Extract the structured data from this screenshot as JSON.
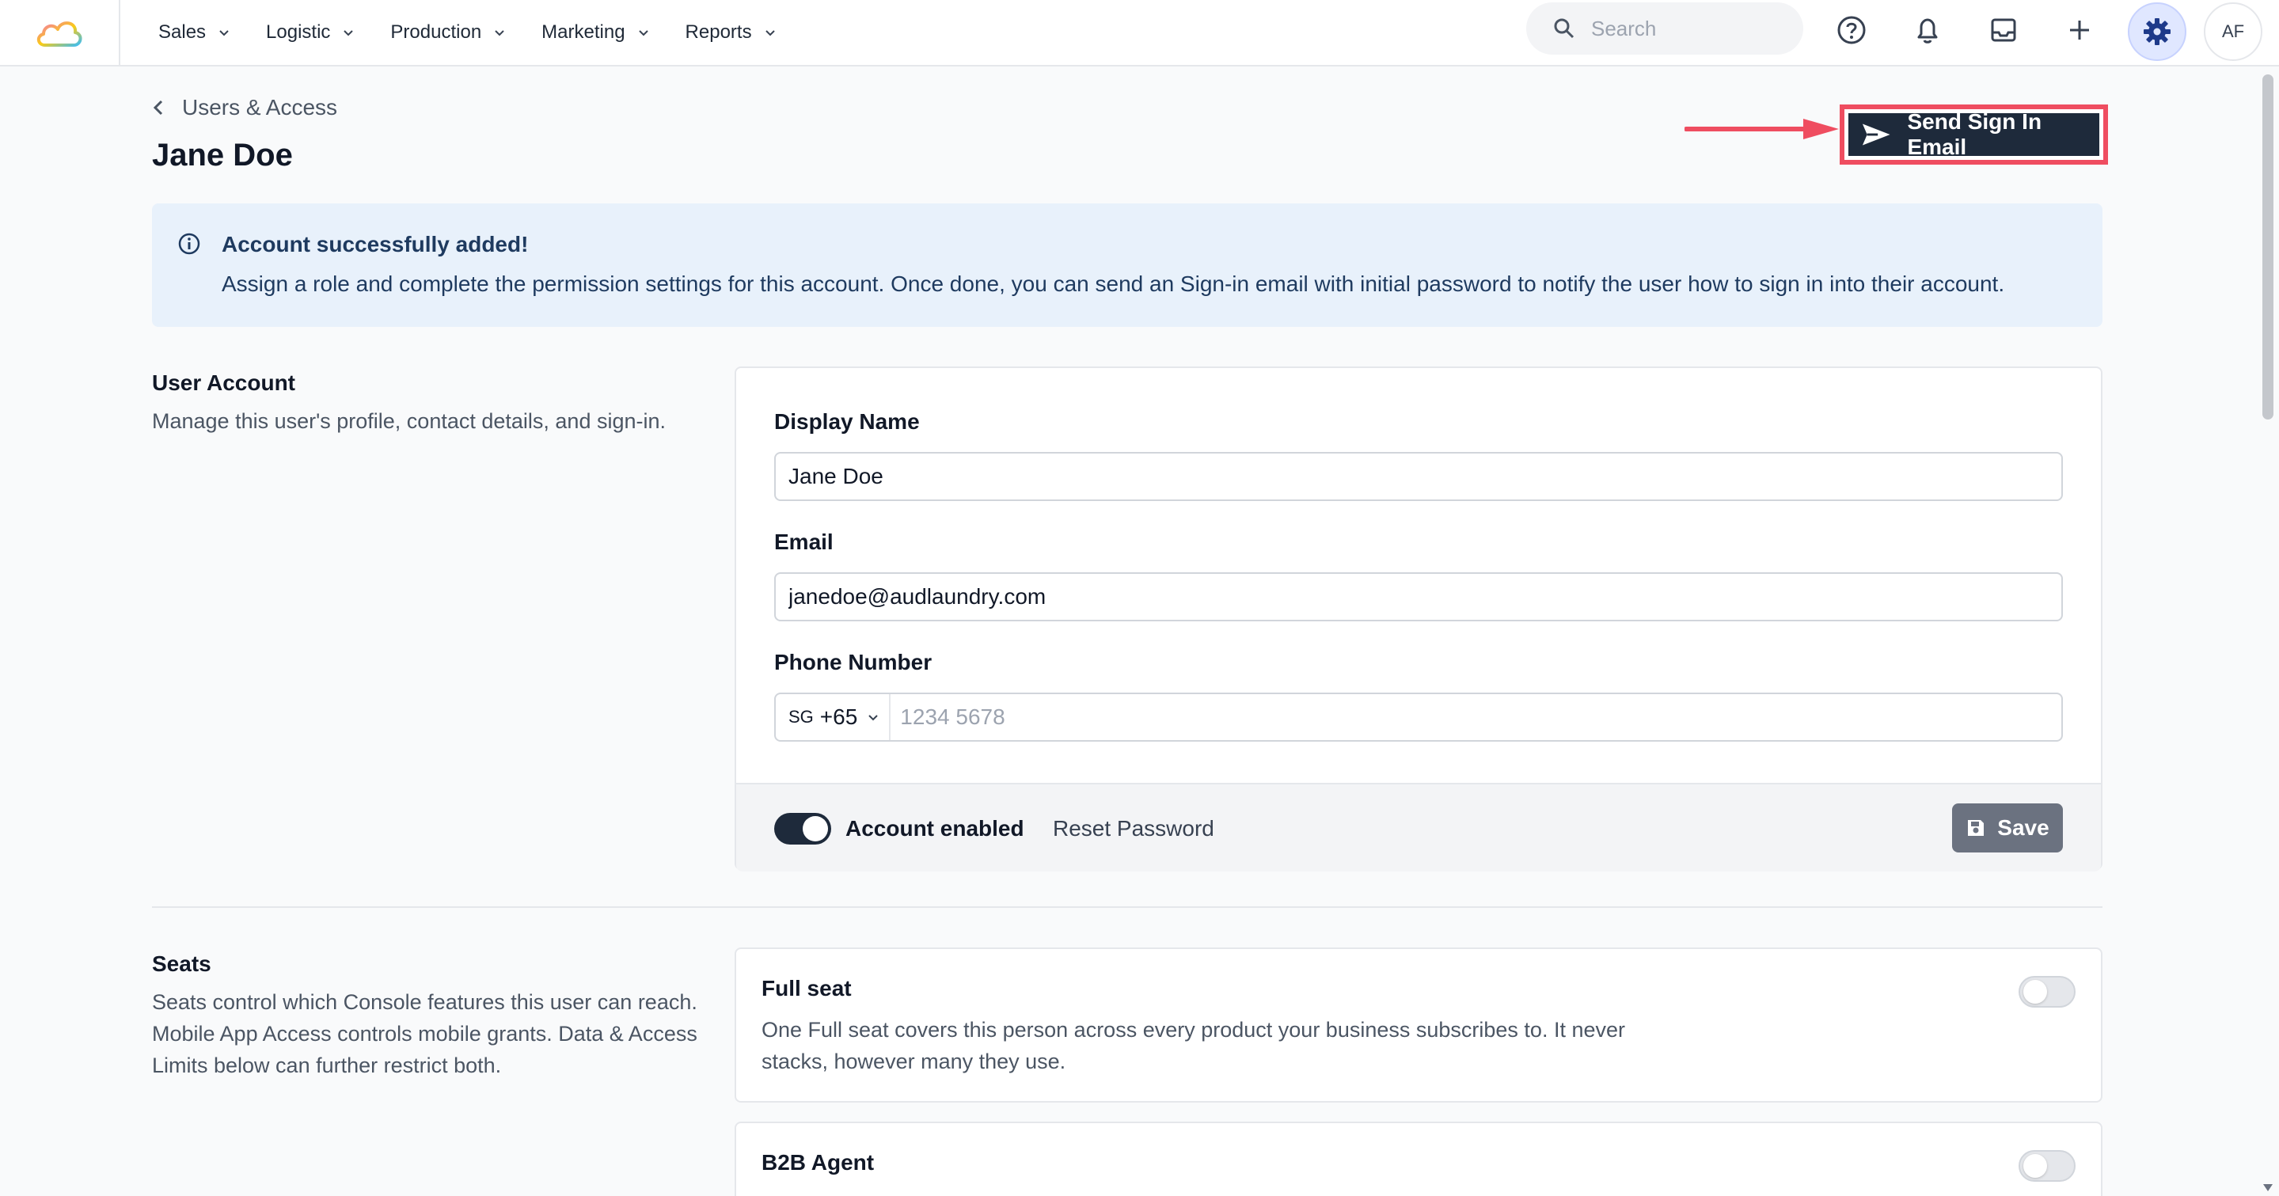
{
  "nav": {
    "items": [
      {
        "label": "Sales"
      },
      {
        "label": "Logistic"
      },
      {
        "label": "Production"
      },
      {
        "label": "Marketing"
      },
      {
        "label": "Reports"
      }
    ]
  },
  "search": {
    "placeholder": "Search"
  },
  "user": {
    "initials": "AF"
  },
  "breadcrumb": {
    "label": "Users & Access"
  },
  "page": {
    "title": "Jane Doe"
  },
  "actions": {
    "send_signin_label": "Send Sign In Email"
  },
  "alert": {
    "title": "Account successfully added!",
    "text": "Assign a role and complete the permission settings for this account. Once done, you can send an Sign-in email with initial password to notify the user how to sign in into their account."
  },
  "user_account": {
    "title": "User Account",
    "description": "Manage this user's profile, contact details, and sign-in.",
    "display_name_label": "Display Name",
    "display_name_value": "Jane Doe",
    "email_label": "Email",
    "email_value": "janedoe@audlaundry.com",
    "phone_label": "Phone Number",
    "phone_country_iso": "SG",
    "phone_country_code": "+65",
    "phone_placeholder": "1234 5678",
    "account_enabled_label": "Account enabled",
    "account_enabled": true,
    "reset_password_label": "Reset Password",
    "save_label": "Save"
  },
  "seats": {
    "title": "Seats",
    "description": "Seats control which Console features this user can reach. Mobile App Access controls mobile grants. Data & Access Limits below can further restrict both.",
    "items": [
      {
        "title": "Full seat",
        "description": "One Full seat covers this person across every product your business subscribes to. It never stacks, however many they use.",
        "enabled": false
      },
      {
        "title": "B2B Agent",
        "description": "",
        "enabled": false
      }
    ]
  },
  "colors": {
    "primary": "#1e2a3b",
    "annotation": "#ef4d60",
    "alert_bg": "#e8f1fb"
  }
}
